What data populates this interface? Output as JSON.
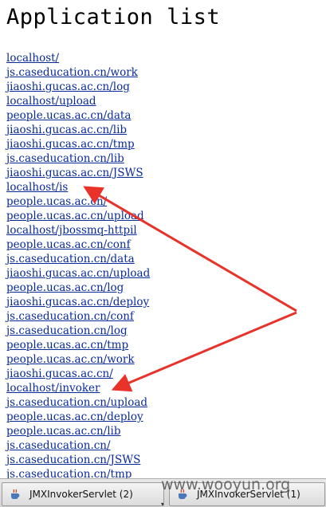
{
  "page": {
    "title": "Application list"
  },
  "links": [
    "localhost/",
    "js.caseducation.cn/work",
    "jiaoshi.gucas.ac.cn/log",
    "localhost/upload",
    "people.ucas.ac.cn/data",
    "jiaoshi.gucas.ac.cn/lib",
    "jiaoshi.gucas.ac.cn/tmp",
    "js.caseducation.cn/lib",
    "jiaoshi.gucas.ac.cn/JSWS",
    "localhost/is",
    "people.ucas.ac.cn/",
    "people.ucas.ac.cn/upload",
    "localhost/jbossmq-httpil",
    "people.ucas.ac.cn/conf",
    "js.caseducation.cn/data",
    "jiaoshi.gucas.ac.cn/upload",
    "people.ucas.ac.cn/log",
    "jiaoshi.gucas.ac.cn/deploy",
    "js.caseducation.cn/conf",
    "js.caseducation.cn/log",
    "people.ucas.ac.cn/tmp",
    "people.ucas.ac.cn/work",
    "jiaoshi.gucas.ac.cn/",
    "localhost/invoker",
    "js.caseducation.cn/upload",
    "people.ucas.ac.cn/deploy",
    "people.ucas.ac.cn/lib",
    "js.caseducation.cn/",
    "js.caseducation.cn/JSWS",
    "js.caseducation.cn/tmp"
  ],
  "annotations": {
    "arrow_color": "#e8322a"
  },
  "taskbar": {
    "buttons": [
      {
        "label": "JMXInvokerServlet (2)",
        "icon": "java-cup-icon"
      },
      {
        "label": "JMXInvokerServlet (1)",
        "icon": "java-cup-icon"
      }
    ]
  },
  "watermark": "www.wooyun.org"
}
